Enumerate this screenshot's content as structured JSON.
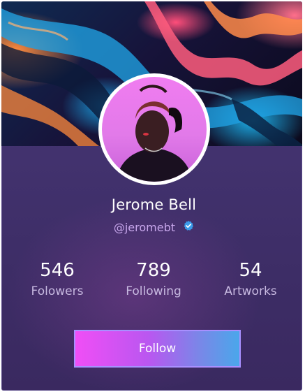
{
  "profile": {
    "name": "Jerome Bell",
    "handle": "@jeromebt",
    "verified": true
  },
  "stats": [
    {
      "value": "546",
      "label": "Folowers"
    },
    {
      "value": "789",
      "label": "Following"
    },
    {
      "value": "54",
      "label": "Artworks"
    }
  ],
  "actions": {
    "follow_label": "Follow"
  },
  "colors": {
    "card_bg": "#42326e",
    "button_gradient_start": "#f04ef6",
    "button_gradient_end": "#4aa7ea",
    "handle_text": "#c8a7ec",
    "verified_badge": "#3b9bea"
  },
  "icons": {
    "verified": "verified-check-icon"
  }
}
